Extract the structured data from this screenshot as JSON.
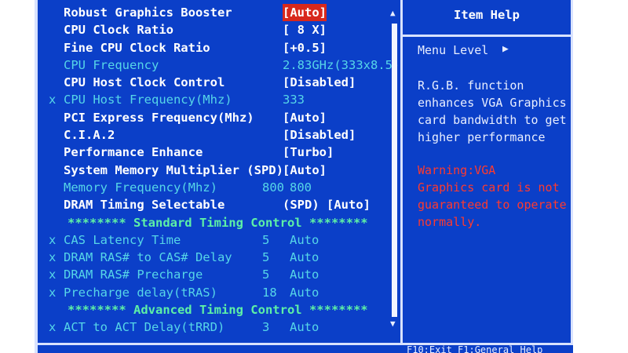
{
  "settings": [
    {
      "marker": "",
      "label": "Robust Graphics Booster",
      "value": "[Auto]",
      "state": "selected"
    },
    {
      "marker": "",
      "label": "CPU Clock Ratio",
      "value": "[ 8 X]",
      "state": "normal"
    },
    {
      "marker": "",
      "label": "Fine CPU Clock Ratio",
      "value": "[+0.5]",
      "state": "normal"
    },
    {
      "marker": "",
      "label": "CPU Frequency",
      "value": "2.83GHz(333x8.5)",
      "state": "info"
    },
    {
      "marker": "",
      "label": "CPU Host Clock Control",
      "value": "[Disabled]",
      "state": "normal"
    },
    {
      "marker": "x",
      "label": "CPU Host Frequency(Mhz)",
      "value": "333",
      "state": "disabled"
    },
    {
      "marker": "",
      "label": "PCI Express Frequency(Mhz)",
      "value": "[Auto]",
      "state": "normal"
    },
    {
      "marker": "",
      "label": "C.I.A.2",
      "value": "[Disabled]",
      "state": "normal"
    },
    {
      "marker": "",
      "label": "Performance Enhance",
      "value": "[Turbo]",
      "state": "normal"
    },
    {
      "marker": "",
      "label": "System Memory Multiplier (SPD)",
      "value": "[Auto]",
      "state": "normal"
    },
    {
      "marker": "",
      "label": "Memory Frequency(Mhz)",
      "col1": "800",
      "col2": "800",
      "state": "info2"
    },
    {
      "marker": "",
      "label": "DRAM Timing Selectable",
      "value": "(SPD) [Auto]",
      "state": "normal"
    },
    {
      "label": "******** Standard Timing Control ********",
      "state": "section"
    },
    {
      "marker": "x",
      "label": "CAS Latency Time",
      "col1": "5",
      "col2": "Auto",
      "state": "disabled2"
    },
    {
      "marker": "x",
      "label": "DRAM RAS# to CAS# Delay",
      "col1": "5",
      "col2": "Auto",
      "state": "disabled2"
    },
    {
      "marker": "x",
      "label": "DRAM RAS# Precharge",
      "col1": "5",
      "col2": "Auto",
      "state": "disabled2"
    },
    {
      "marker": "x",
      "label": "Precharge delay(tRAS)",
      "col1": "18",
      "col2": "Auto",
      "state": "disabled2"
    },
    {
      "label": "******** Advanced Timing Control ********",
      "state": "section"
    },
    {
      "marker": "x",
      "label": "ACT to ACT Delay(tRRD)",
      "col1": "3",
      "col2": "Auto",
      "state": "disabled2"
    }
  ],
  "scrollbar": {
    "up_icon": "▲",
    "down_icon": "▼"
  },
  "help": {
    "title": "Item Help",
    "menu_level_label": "Menu Level",
    "menu_level_arrow": "▶",
    "description": "R.G.B. function\nenhances VGA Graphics\ncard bandwidth to get\nhigher performance",
    "warning": "Warning:VGA\nGraphics card is not\nguaranteed to operate\nnormally."
  },
  "footer": {
    "partial_text": "F10:Exit  F1:General Help"
  },
  "colors": {
    "background": "#0b3fc8",
    "label": "#ffffff",
    "disabled": "#56d6e8",
    "section": "#5df0a6",
    "selected": "#d8281c",
    "warning": "#ff3a2e"
  }
}
